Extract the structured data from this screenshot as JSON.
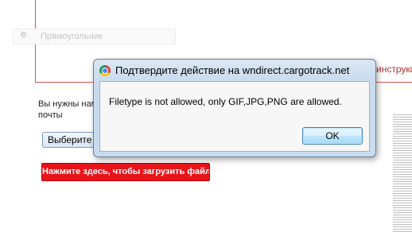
{
  "background_page": {
    "shape_label": "Прямоугольник",
    "right_edge_text": "инструкц",
    "text_line1": "Вы нужны нам",
    "text_line2": "почты",
    "choose_button_label": "Выберите",
    "upload_button_label": "Нажмите здесь, чтобы загрузить файл"
  },
  "dialog": {
    "title": "Подтвердите действие на wndirect.cargotrack.net",
    "message": "Filetype is not allowed, only GIF,JPG,PNG are allowed.",
    "ok_label": "OK"
  },
  "colors": {
    "upload_button": "#e8141a",
    "panel_border": "#d9534f"
  },
  "icons": {
    "dialog_icon": "chrome-icon",
    "shape_row_icon": "gear-icon"
  }
}
